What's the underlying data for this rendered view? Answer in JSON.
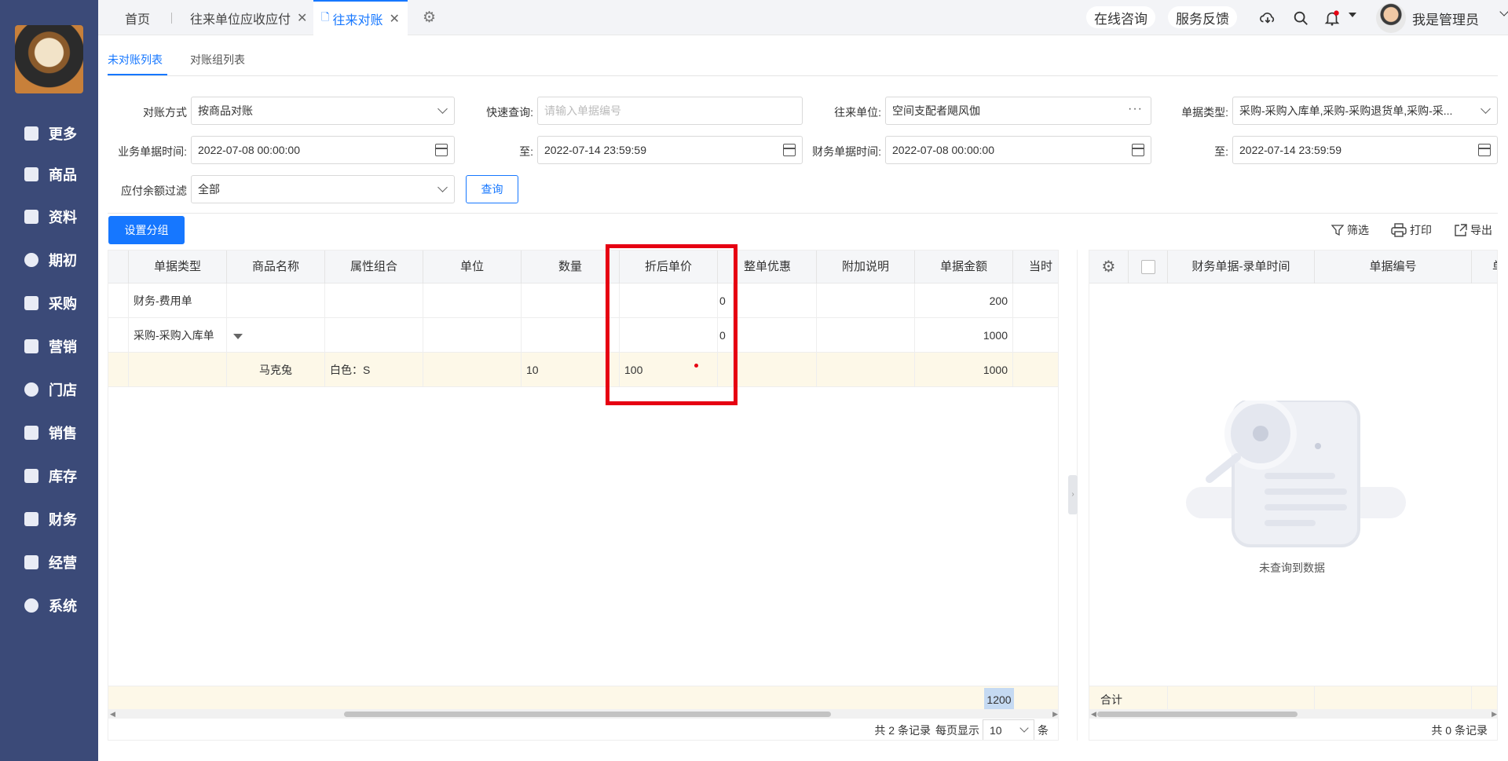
{
  "sidebar": {
    "items": [
      {
        "label": "更多"
      },
      {
        "label": "商品"
      },
      {
        "label": "资料"
      },
      {
        "label": "期初"
      },
      {
        "label": "采购"
      },
      {
        "label": "营销"
      },
      {
        "label": "门店"
      },
      {
        "label": "销售"
      },
      {
        "label": "库存"
      },
      {
        "label": "财务"
      },
      {
        "label": "经营"
      },
      {
        "label": "系统"
      }
    ]
  },
  "tabs": [
    {
      "label": "首页"
    },
    {
      "label": "往来单位应收应付"
    },
    {
      "label": "往来对账"
    }
  ],
  "topbar": {
    "consult": "在线咨询",
    "feedback": "服务反馈",
    "user_name": "我是管理员"
  },
  "subtabs": [
    {
      "label": "未对账列表"
    },
    {
      "label": "对账组列表"
    }
  ],
  "filters": {
    "mode_label": "对账方式",
    "mode_value": "按商品对账",
    "quick_label": "快速查询:",
    "quick_placeholder": "请输入单据编号",
    "partner_label": "往来单位:",
    "partner_value": "空间支配者飓风伽",
    "doctype_label": "单据类型:",
    "doctype_value": "采购-采购入库单,采购-采购退货单,采购-采...",
    "biz_time_label": "业务单据时间:",
    "biz_time_from": "2022-07-08 00:00:00",
    "to_label": "至:",
    "biz_time_to": "2022-07-14 23:59:59",
    "fin_time_label": "财务单据时间:",
    "fin_time_from": "2022-07-08 00:00:00",
    "fin_time_to": "2022-07-14 23:59:59",
    "balance_label": "应付余额过滤",
    "balance_value": "全部",
    "query_button": "查询"
  },
  "toolbar": {
    "group_button": "设置分组",
    "filter": "筛选",
    "print": "打印",
    "export": "导出"
  },
  "left_table": {
    "headers": [
      "单据类型",
      "商品名称",
      "属性组合",
      "单位",
      "数量",
      "折后单价",
      "整单优惠",
      "附加说明",
      "单据金额",
      "当时"
    ],
    "rows": [
      {
        "type": "财务-费用单",
        "name": "",
        "attr": "",
        "unit": "",
        "qty": "",
        "price": "",
        "price_extra": "0",
        "discount": "",
        "note": "",
        "amount": "200"
      },
      {
        "type": "采购-采购入库单",
        "name": "",
        "attr": "",
        "unit": "",
        "qty": "",
        "price": "",
        "price_extra": "0",
        "discount": "",
        "note": "",
        "amount": "1000"
      },
      {
        "type": "",
        "name": "马克兔",
        "attr": "白色：S",
        "unit": "",
        "qty": "10",
        "price": "100",
        "price_extra": "",
        "discount": "",
        "note": "",
        "amount": "1000"
      }
    ],
    "footer_total": "1200",
    "pager": {
      "total_text": "共 2 条记录",
      "per_page_label": "每页显示",
      "page_size": "10",
      "unit": "条"
    }
  },
  "right_table": {
    "headers": [
      "财务单据-录单时间",
      "单据编号",
      "单"
    ],
    "empty_text": "未查询到数据",
    "footer_label": "合计",
    "pager_text": "共 0 条记录"
  },
  "colors": {
    "sidebar": "#3b4a78",
    "accent": "#1677ff",
    "highlight": "#e60012"
  }
}
